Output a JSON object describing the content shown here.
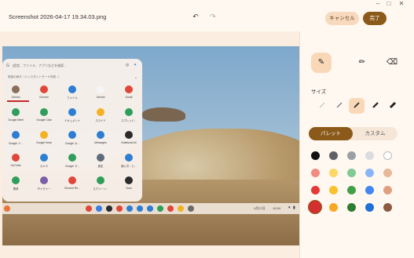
{
  "window": {
    "filename": "Screenshot 2026-04-17 19.34.03.png",
    "cancel_label": "キャンセル",
    "done_label": "完了",
    "undo_icon": "undo-icon",
    "redo_icon": "redo-icon",
    "minimize_icon": "minimize-icon",
    "maximize_icon": "maximize-icon",
    "close_icon": "close-icon"
  },
  "launcher": {
    "search_placeholder": "[設定、ファイル、アプリなどを検索...",
    "continue_label": "前回の続き（インスタントモード作成...）",
    "apps": [
      {
        "label": "Gemini",
        "color": "#8a6d5a"
      },
      {
        "label": "Chrome",
        "color": "#e0463a"
      },
      {
        "label": "ファイル",
        "color": "#2d7dd2"
      },
      {
        "label": "Gemini",
        "color": "#f5f5f5"
      },
      {
        "label": "Gmail",
        "color": "#e0463a"
      },
      {
        "label": "Google Meet",
        "color": "#2e9e5a"
      },
      {
        "label": "Google Chat",
        "color": "#2e9e5a"
      },
      {
        "label": "ドキュメント",
        "color": "#2d7dd2"
      },
      {
        "label": "スライド",
        "color": "#f3b223"
      },
      {
        "label": "スプレッド...",
        "color": "#2e9e5a"
      },
      {
        "label": "Google ド...",
        "color": "#2d7dd2"
      },
      {
        "label": "Google Keep",
        "color": "#f3b223"
      },
      {
        "label": "Google カ...",
        "color": "#2d7dd2"
      },
      {
        "label": "Messages",
        "color": "#2d7dd2"
      },
      {
        "label": "NotebookLM",
        "color": "#2b2b2b"
      },
      {
        "label": "YouTube",
        "color": "#e0463a"
      },
      {
        "label": "カメラ",
        "color": "#2d7dd2"
      },
      {
        "label": "Google マ...",
        "color": "#2e9e5a"
      },
      {
        "label": "設定",
        "color": "#5f6b7a"
      },
      {
        "label": "使い方・ヒ...",
        "color": "#2d7dd2"
      },
      {
        "label": "電卓",
        "color": "#2e9e5a"
      },
      {
        "label": "ギャラリー",
        "color": "#7b5ea7"
      },
      {
        "label": "Chrome Re...",
        "color": "#e0463a"
      },
      {
        "label": "スクリーン...",
        "color": "#2e9e5a"
      },
      {
        "label": "Sora",
        "color": "#2b2b2b"
      }
    ]
  },
  "shelf": {
    "date": "4月17日",
    "time": "19:34",
    "icons": [
      {
        "name": "chrome-icon",
        "color": "#e0463a"
      },
      {
        "name": "gemini-icon",
        "color": "#3b7de0"
      },
      {
        "name": "notebooklm-icon",
        "color": "#2b2b2b"
      },
      {
        "name": "gmail-icon",
        "color": "#e0463a"
      },
      {
        "name": "files-icon",
        "color": "#2d7dd2"
      },
      {
        "name": "docs-icon",
        "color": "#2d7dd2"
      },
      {
        "name": "messages-icon",
        "color": "#2d7dd2"
      },
      {
        "name": "meet-icon",
        "color": "#2e9e5a"
      },
      {
        "name": "youtube-icon",
        "color": "#e0463a"
      },
      {
        "name": "drive-icon",
        "color": "#f3b223"
      },
      {
        "name": "terminal-icon",
        "color": "#6b6b6b"
      }
    ]
  },
  "tools": {
    "items": [
      {
        "name": "pen-tool",
        "icon": "pen-icon",
        "active": true
      },
      {
        "name": "marker-tool",
        "icon": "marker-icon",
        "active": false
      },
      {
        "name": "eraser-tool",
        "icon": "eraser-icon",
        "active": false
      }
    ],
    "size_label": "サイズ",
    "selected_size_index": 2,
    "palette_tab": "パレット",
    "custom_tab": "カスタム",
    "selected_color": "#d32f2f",
    "colors": [
      "#111111",
      "#5f6368",
      "#9aa0a6",
      "#dadce0",
      "#ffffff",
      "#f28b82",
      "#fdd663",
      "#81c995",
      "#8ab4f8",
      "#e8b89a",
      "#e53935",
      "#fbc02d",
      "#43a047",
      "#4285f4",
      "#e0a080",
      "#d32f2f",
      "#f9a825",
      "#2e7d32",
      "#1e6fd9",
      "#8d5a44"
    ]
  }
}
